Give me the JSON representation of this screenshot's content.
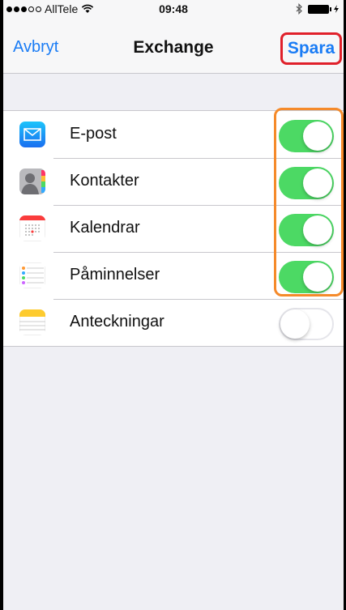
{
  "status_bar": {
    "carrier": "AllTele",
    "time": "09:48"
  },
  "nav": {
    "cancel_label": "Avbryt",
    "title": "Exchange",
    "save_label": "Spara"
  },
  "accounts": [
    {
      "label": "E-post",
      "icon": "mail-icon",
      "enabled": true
    },
    {
      "label": "Kontakter",
      "icon": "contacts-icon",
      "enabled": true
    },
    {
      "label": "Kalendrar",
      "icon": "calendar-icon",
      "enabled": true
    },
    {
      "label": "Påminnelser",
      "icon": "reminders-icon",
      "enabled": true
    },
    {
      "label": "Anteckningar",
      "icon": "notes-icon",
      "enabled": false
    }
  ],
  "colors": {
    "accent": "#1a7cf5",
    "toggle_on": "#4cd964",
    "highlight_save": "#e0202a",
    "highlight_toggles": "#f58a2a"
  }
}
